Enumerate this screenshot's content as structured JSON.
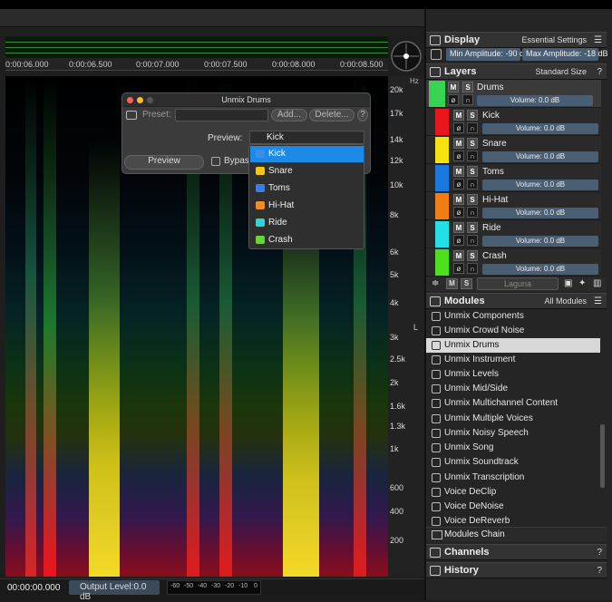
{
  "timeline": {
    "ticks": [
      "0:00:06.000",
      "0:00:06.500",
      "0:00:07.000",
      "0:00:07.500",
      "0:00:08.000",
      "0:00:08.500"
    ]
  },
  "freq_axis": {
    "unit": "Hz",
    "channel": "L",
    "labels": [
      "20k",
      "17k",
      "14k",
      "12k",
      "10k",
      "8k",
      "6k",
      "5k",
      "4k",
      "3k",
      "2.5k",
      "2k",
      "1.6k",
      "1.3k",
      "1k",
      "600",
      "400",
      "200"
    ]
  },
  "status": {
    "time": "00:00:00.000",
    "output_label": "Output Level:",
    "output_value": "0.0 dB",
    "meter_ticks": [
      "-60",
      "-50",
      "-40",
      "-30",
      "-20",
      "-10",
      "0"
    ]
  },
  "display": {
    "title": "Display",
    "preset": "Essential Settings",
    "min_amp": "Min Amplitude: -90 dB",
    "max_amp": "Max Amplitude: -18 dB"
  },
  "layers": {
    "title": "Layers",
    "size": "Standard Size",
    "items": [
      {
        "name": "Drums",
        "volume": "Volume: 0.0 dB",
        "color": "#39d353"
      },
      {
        "name": "Kick",
        "volume": "Volume: 0.0 dB",
        "color": "#e8151b"
      },
      {
        "name": "Snare",
        "volume": "Volume: 0.0 dB",
        "color": "#f5e20f"
      },
      {
        "name": "Toms",
        "volume": "Volume: 0.0 dB",
        "color": "#1b78e0"
      },
      {
        "name": "Hi-Hat",
        "volume": "Volume: 0.0 dB",
        "color": "#f27d14"
      },
      {
        "name": "Ride",
        "volume": "Volume: 0.0 dB",
        "color": "#23e0e6"
      },
      {
        "name": "Crash",
        "volume": "Volume: 0.0 dB",
        "color": "#4de01e"
      }
    ],
    "mute": "M",
    "solo": "S",
    "blend": "Laguna"
  },
  "modules": {
    "title": "Modules",
    "filter": "All Modules",
    "items": [
      "Unmix Components",
      "Unmix Crowd Noise",
      "Unmix Drums",
      "Unmix Instrument",
      "Unmix Levels",
      "Unmix Mid/Side",
      "Unmix Multichannel Content",
      "Unmix Multiple Voices",
      "Unmix Noisy Speech",
      "Unmix Song",
      "Unmix Soundtrack",
      "Unmix Transcription",
      "Voice DeClip",
      "Voice DeNoise",
      "Voice DeReverb"
    ],
    "selected": "Unmix Drums",
    "chain": "Modules Chain"
  },
  "channels": {
    "title": "Channels"
  },
  "history": {
    "title": "History"
  },
  "dialog": {
    "title": "Unmix Drums",
    "preset_label": "Preset:",
    "add": "Add...",
    "delete": "Delete...",
    "help": "?",
    "preview_label": "Preview:",
    "preview_value": "Kick",
    "preview_button": "Preview",
    "bypass": "Bypass",
    "options": [
      {
        "label": "Kick",
        "color": "#3b8fe8"
      },
      {
        "label": "Snare",
        "color": "#f5c518"
      },
      {
        "label": "Toms",
        "color": "#3b7de8"
      },
      {
        "label": "Hi-Hat",
        "color": "#f28c28"
      },
      {
        "label": "Ride",
        "color": "#2fd4d4"
      },
      {
        "label": "Crash",
        "color": "#6ad43b"
      }
    ],
    "selected": "Kick"
  }
}
